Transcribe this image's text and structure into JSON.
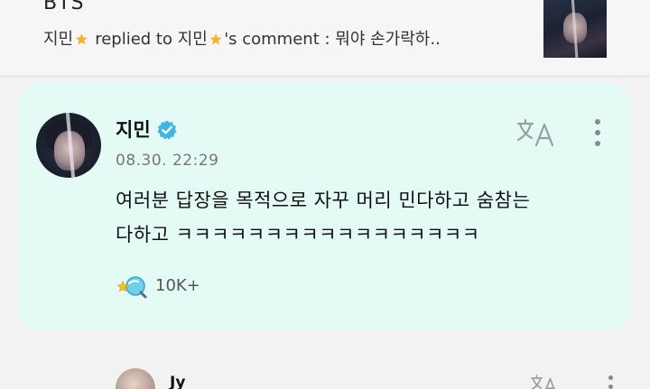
{
  "notification": {
    "group_name": "BTS",
    "actor": "지민",
    "action": " replied to ",
    "target": "지민",
    "suffix": "'s comment : 뭐야 손가락하..",
    "thumbnail_icon": "member-photo"
  },
  "comment": {
    "author": "지민",
    "verified_icon": "verified-badge-icon",
    "timestamp": "08.30. 22:29",
    "body_line1": "여러분 답장을 목적으로 자꾸 머리 민다하고 숨참는",
    "body_line2": "다하고 ㅋㅋㅋㅋㅋㅋㅋㅋㅋㅋㅋㅋㅋㅋㅋㅋㅋ",
    "likes": "10K+",
    "like_icon": "like-reaction-icon",
    "translate_icon": "translate-icon",
    "more_icon": "more-vertical-icon"
  },
  "next_comment": {
    "author": "Jy"
  },
  "colors": {
    "card_background": "#e3faf5",
    "verified": "#3fb6e8",
    "star": "#f6b51b",
    "page_background": "#f2f2f2"
  }
}
